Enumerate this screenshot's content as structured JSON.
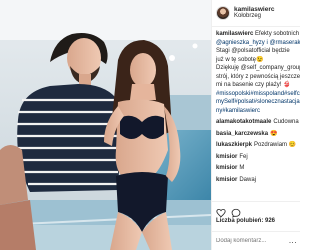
{
  "post": {
    "username": "kamilaswierc",
    "follow_label": "Obserwuj",
    "location": "Kołobrzeg",
    "caption_lines": [
      "Efekty sobotnich",
      "@agnieszka_hyzy i @rmaserak",
      "Stagi @polsatofficial będzie",
      "już w tę sobotę😉",
      "Dziękuję @self_company_group",
      "strój, który z pewnością jeszcze",
      "mi na basenie czy plaży! 👙",
      "#missopolski#misspoland#selfco",
      "mySelf#polsat#slonecznastacja",
      "ny#kamilaswierc"
    ],
    "comments": [
      {
        "user": "alamakotakotmaale",
        "text": "Cudowna"
      },
      {
        "user": "basia_karczewska",
        "text": "😍"
      },
      {
        "user": "lukaszkierpk",
        "text": "Pozdrawiam 😊"
      },
      {
        "user": "kmisior",
        "text": "Fej"
      },
      {
        "user": "kmisior",
        "text": "M"
      },
      {
        "user": "kmisior",
        "text": "Dawaj"
      }
    ],
    "likes": "Liczba polubień: 926",
    "time": "15 GODZ.",
    "add_comment_placeholder": "Dodaj komentarz...",
    "more_options": "..."
  },
  "icons": {
    "like": "heart-outline-icon",
    "comment": "speech-bubble-icon"
  },
  "colors": {
    "link": "#003569",
    "border": "#efefef",
    "text": "#262626"
  }
}
